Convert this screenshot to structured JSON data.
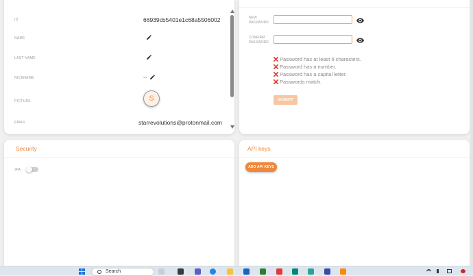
{
  "profile": {
    "fields": [
      {
        "key": "id",
        "label": "ID",
        "value": "66939cb5401e1c68a5506002"
      },
      {
        "key": "name",
        "label": "NAME",
        "value": ""
      },
      {
        "key": "last_name",
        "label": "LAST NAME",
        "value": ""
      },
      {
        "key": "nickname",
        "label": "NICKNAME",
        "value": "--"
      },
      {
        "key": "picture",
        "label": "PICTURE",
        "avatar_initial": "S"
      },
      {
        "key": "email",
        "label": "EMAIL",
        "value": "starrevolutions@protonmail.com"
      }
    ]
  },
  "password": {
    "new_label": "NEW PASSWORD",
    "confirm_label": "CONFIRM PASSWORD",
    "new_value": "",
    "confirm_value": "",
    "rules": [
      "Password has at least 6 characters.",
      "Password has a number.",
      "Password has a capital letter.",
      "Passwords match."
    ],
    "submit_label": "SUBMIT"
  },
  "security": {
    "title": "Security",
    "tfa_label": "2FA",
    "tfa_enabled": false
  },
  "api_keys": {
    "title": "API keys",
    "add_label": "ADD API KEYS"
  },
  "taskbar": {
    "search_placeholder": "Search"
  },
  "colors": {
    "accent": "#f0873a",
    "input_border": "#f2a25c",
    "submit_disabled": "#f8c6a0",
    "error_x": "#e53935",
    "avatar_bg": "#fdf0e6"
  },
  "icons": {
    "edit": "pencil-icon",
    "visibility": "eye-icon",
    "rule_fail": "x-icon",
    "start": "windows-start-icon",
    "search": "search-icon"
  }
}
